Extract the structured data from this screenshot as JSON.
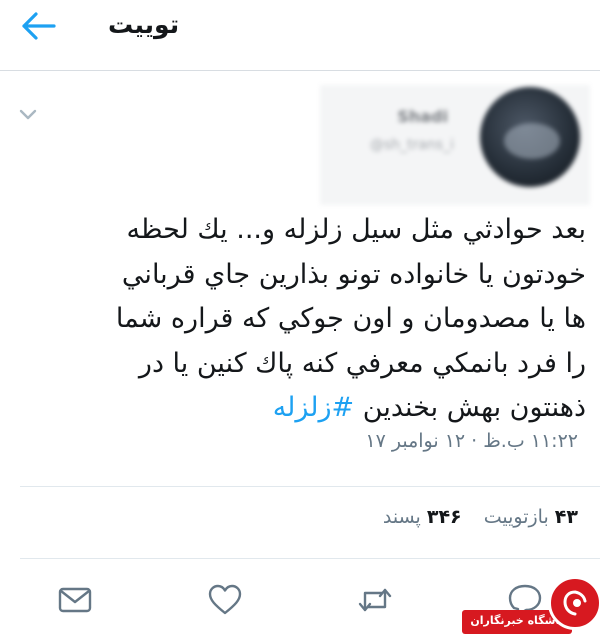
{
  "header": {
    "title": "توییت",
    "back_icon": "arrow-left-icon"
  },
  "tweet": {
    "author_name": "Shadi",
    "author_handle": "@sh_trans_i",
    "text_lines": [
      "بعد حوادثي مثل سيل زلزله و... يك لحظه",
      "خودتون يا خانواده تونو بذارين جاي قرباني",
      "ها يا مصدومان و اون جوكي كه قراره شما",
      "را فرد بانمكي معرفي كنه پاك كنين يا در"
    ],
    "last_line_text": "ذهنتون بهش بخندين",
    "hashtag": "#زلزله",
    "timestamp": "۱۱:۲۲ ب.ظ · ۱۲ نوامبر ۱۷",
    "accent_color": "#1da1f2"
  },
  "stats": {
    "retweets_count": "۴۳",
    "retweets_label": "بازتوییت",
    "likes_count": "۳۴۶",
    "likes_label": "پسند"
  },
  "actions": [
    {
      "name": "mail-icon"
    },
    {
      "name": "heart-icon"
    },
    {
      "name": "retweet-icon"
    },
    {
      "name": "reply-icon"
    }
  ],
  "watermark": {
    "text": "باشگاه خبرنگاران",
    "logo_color": "#d71920"
  }
}
